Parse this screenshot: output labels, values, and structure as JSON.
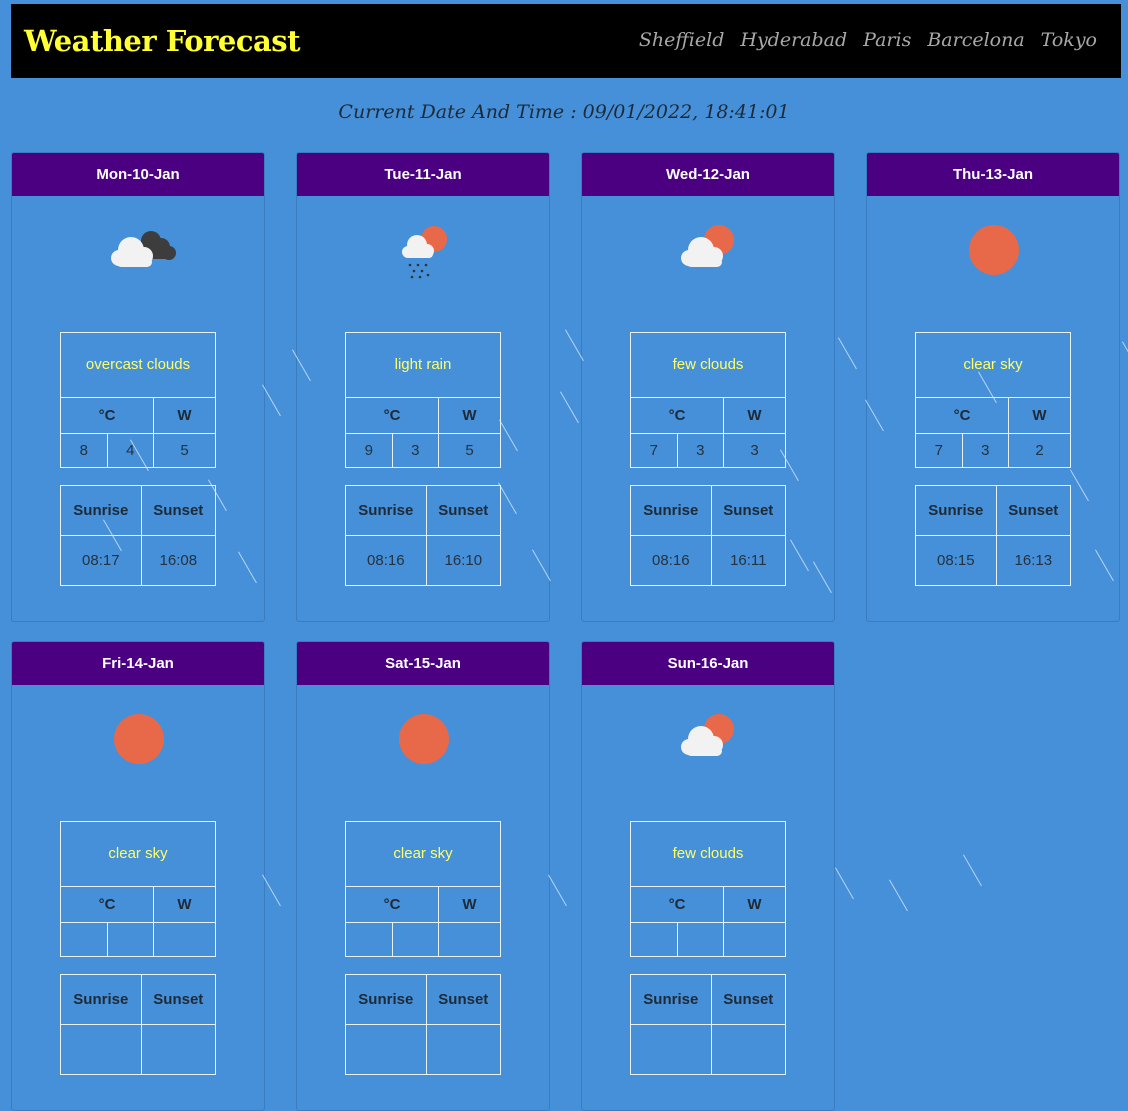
{
  "header": {
    "brand": "Weather Forecast",
    "cities": [
      "Sheffield",
      "Hyderabad",
      "Paris",
      "Barcelona",
      "Tokyo"
    ]
  },
  "datetime": "Current Date And Time : 09/01/2022, 18:41:01",
  "table_labels": {
    "celsius": "°C",
    "wind": "W",
    "sunrise": "Sunrise",
    "sunset": "Sunset"
  },
  "colors": {
    "background": "#4590d8",
    "card_header": "#4b0082",
    "brand": "#ffff33",
    "description": "#ffff66",
    "sun": "#e8694a"
  },
  "days": [
    {
      "date": "Mon-10-Jan",
      "icon": "overcast-clouds-icon",
      "description": "overcast clouds",
      "temp_a": "8",
      "temp_b": "4",
      "wind": "5",
      "sunrise": "08:17",
      "sunset": "16:08"
    },
    {
      "date": "Tue-11-Jan",
      "icon": "light-rain-icon",
      "description": "light rain",
      "temp_a": "9",
      "temp_b": "3",
      "wind": "5",
      "sunrise": "08:16",
      "sunset": "16:10"
    },
    {
      "date": "Wed-12-Jan",
      "icon": "few-clouds-icon",
      "description": "few clouds",
      "temp_a": "7",
      "temp_b": "3",
      "wind": "3",
      "sunrise": "08:16",
      "sunset": "16:11"
    },
    {
      "date": "Thu-13-Jan",
      "icon": "clear-sky-icon",
      "description": "clear sky",
      "temp_a": "7",
      "temp_b": "3",
      "wind": "2",
      "sunrise": "08:15",
      "sunset": "16:13"
    },
    {
      "date": "Fri-14-Jan",
      "icon": "clear-sky-icon",
      "description": "clear sky"
    },
    {
      "date": "Sat-15-Jan",
      "icon": "clear-sky-icon",
      "description": "clear sky"
    },
    {
      "date": "Sun-16-Jan",
      "icon": "few-clouds-icon",
      "description": "few clouds"
    }
  ]
}
